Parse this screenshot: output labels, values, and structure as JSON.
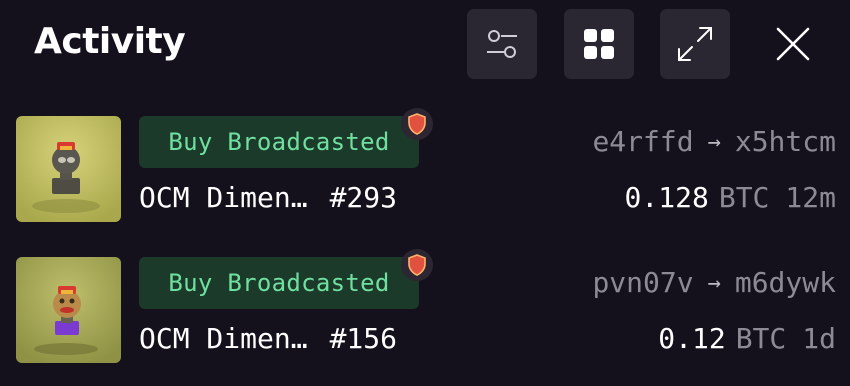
{
  "header": {
    "title": "Activity",
    "buttons": [
      {
        "icon": "sliders-icon"
      },
      {
        "icon": "grid-icon"
      },
      {
        "icon": "expand-icon"
      },
      {
        "icon": "close-icon"
      }
    ]
  },
  "activities": [
    {
      "status": "Buy Broadcasted",
      "name": "OCM Dimen…",
      "id": "#293",
      "from": "e4rffd",
      "to": "x5htcm",
      "arrow": "→",
      "amount": "0.128",
      "currency": "BTC",
      "time": "12m",
      "shield_icon": "shield-icon"
    },
    {
      "status": "Buy Broadcasted",
      "name": "OCM Dimen…",
      "id": "#156",
      "from": "pvn07v",
      "to": "m6dywk",
      "arrow": "→",
      "amount": "0.12",
      "currency": "BTC",
      "time": "1d",
      "shield_icon": "shield-icon"
    }
  ],
  "colors": {
    "background": "#14111c",
    "button_bg": "#2a2733",
    "badge_bg": "#1c3a2a",
    "badge_text": "#6fe0a0",
    "muted_text": "#8d8a96",
    "shield": "#e0523f"
  }
}
